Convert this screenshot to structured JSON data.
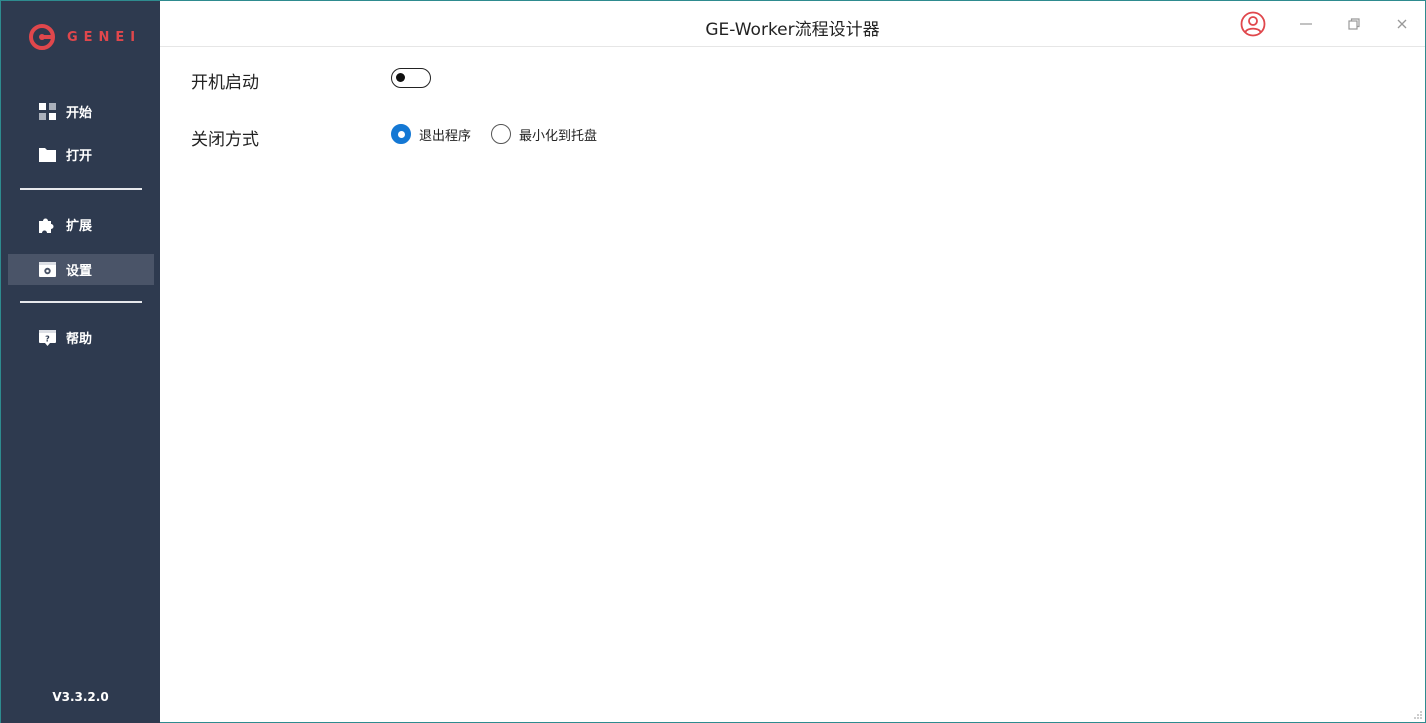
{
  "app": {
    "title": "GE-Worker流程设计器",
    "logo_text": "GENEI",
    "version": "V3.3.2.0",
    "accent_color": "#e0474c",
    "sidebar_color": "#2e3a4f",
    "primary_color": "#1478d4"
  },
  "sidebar": {
    "items": [
      {
        "label": "开始",
        "icon": "grid-icon"
      },
      {
        "label": "打开",
        "icon": "folder-icon"
      },
      {
        "label": "扩展",
        "icon": "puzzle-icon"
      },
      {
        "label": "设置",
        "icon": "settings-icon",
        "active": true
      },
      {
        "label": "帮助",
        "icon": "help-icon"
      }
    ]
  },
  "settings": {
    "autostart": {
      "label": "开机启动",
      "enabled": false
    },
    "close_mode": {
      "label": "关闭方式",
      "options": [
        {
          "label": "退出程序",
          "checked": true
        },
        {
          "label": "最小化到托盘",
          "checked": false
        }
      ]
    }
  }
}
